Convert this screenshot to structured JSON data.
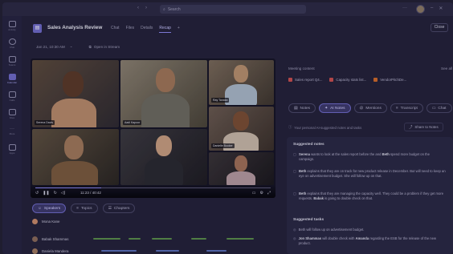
{
  "search": {
    "placeholder": "Search"
  },
  "rail": [
    {
      "label": "Activity"
    },
    {
      "label": "Chat"
    },
    {
      "label": "Teams"
    },
    {
      "label": "Calendar"
    },
    {
      "label": "Calls"
    },
    {
      "label": "Files"
    },
    {
      "label": "More"
    },
    {
      "label": "Apps"
    }
  ],
  "header": {
    "title": "Sales Analysis Review",
    "tabs": [
      {
        "label": "Chat"
      },
      {
        "label": "Files"
      },
      {
        "label": "Details"
      },
      {
        "label": "Recap"
      },
      {
        "label": "+"
      }
    ],
    "close_label": "Close"
  },
  "subhead": {
    "date": "Jan 21, 10:30 AM",
    "open_label": "Open in Stream"
  },
  "video": {
    "participants": [
      {
        "name": "Serena Davis"
      },
      {
        "name": "Aadi Kapoor"
      },
      {
        "name": "Ray Tanaka"
      },
      {
        "name": ""
      },
      {
        "name": ""
      },
      {
        "name": "Danielle Booker"
      },
      {
        "name": ""
      }
    ],
    "time": "11:23 / 40:42",
    "progress": 0.28
  },
  "segments": {
    "tabs": [
      {
        "label": "Speakers"
      },
      {
        "label": "Topics"
      },
      {
        "label": "Chapters"
      }
    ],
    "speakers": [
      {
        "name": "Mona Kane"
      },
      {
        "name": "Babak Shammas"
      },
      {
        "name": "Daniela Mandera"
      }
    ]
  },
  "right": {
    "meeting_content_label": "Meeting content",
    "see_all": "See all",
    "files": [
      {
        "name": "Sales report Q4...",
        "color": "#c94f4f"
      },
      {
        "name": "Capacity stats list...",
        "color": "#c94f4f"
      },
      {
        "name": "VendorPitchDe...",
        "color": "#d06a2b"
      }
    ],
    "tabs": [
      {
        "label": "Notes"
      },
      {
        "label": "AI Notes"
      },
      {
        "label": "Mentions"
      },
      {
        "label": "Transcript"
      },
      {
        "label": "Chat"
      }
    ],
    "ai_hint": "Your personal AI-suggested notes and tasks",
    "share_label": "Share to Notes",
    "suggested_notes_title": "Suggested notes",
    "notes": [
      {
        "who": "Serena",
        "text": " wants to look at the sales report before the and ",
        "who2": "Beth",
        "text2": " spend more budget on the campaign."
      },
      {
        "who": "Beth",
        "text": " explains that they are on track for new product release in December. But will need to keep an eye on advertisement budget. She will follow up on that.",
        "who2": "",
        "text2": ""
      },
      {
        "who": "Beth",
        "text": " explains that they are managing the capacity well. They could be a problem if they get more requests. ",
        "who2": "Babak",
        "text2": " is going to double check on that."
      }
    ],
    "suggested_tasks_title": "Suggested tasks",
    "tasks": [
      {
        "who": "",
        "text": "Beth will follow up on advertisement budget.",
        "who2": "",
        "text2": ""
      },
      {
        "who": "Jon Shammas",
        "text": " will double check with ",
        "who2": "Amanda",
        "text2": " regarding the ESB for the release of the new product."
      }
    ]
  },
  "colors": {
    "accent": "#6f6ac8",
    "background": "#24223a"
  }
}
